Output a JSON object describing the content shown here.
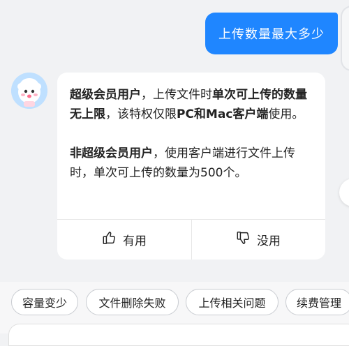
{
  "chat": {
    "user_message": "上传数量最大多少",
    "bot": {
      "para1_bold1": "超级会员用户",
      "para1_text1": "，上传文件时",
      "para1_bold2": "单次可上传的数量无上限",
      "para1_text2": "，该特权仅限",
      "para1_bold3": "PC和Mac客户端",
      "para1_text3": "使用。",
      "para2_bold1": "非超级会员用户",
      "para2_text1": "，使用客户端进行文件上传时，单次可上传的数量为500个。"
    },
    "feedback": {
      "useful": "有用",
      "useless": "没用"
    }
  },
  "suggestions": [
    "容量变少",
    "文件删除失败",
    "上传相关问题",
    "续费管理"
  ],
  "colors": {
    "accent": "#1f86ff",
    "background": "#f1f2f4",
    "card": "#ffffff"
  },
  "icons": {
    "avatar": "assistant-avatar-icon",
    "useful": "thumbs-up-icon",
    "useless": "thumbs-down-icon"
  }
}
